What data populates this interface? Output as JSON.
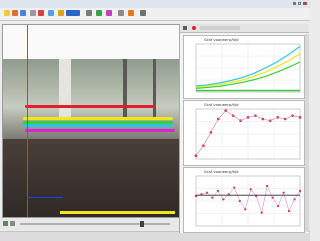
{
  "app": {
    "window_title": "",
    "window_buttons": [
      "minimize",
      "maximize",
      "close"
    ]
  },
  "toolbar": {
    "icons": [
      "new-icon",
      "open-icon",
      "save-icon",
      "undo-icon",
      "redo-icon",
      "zoom-icon",
      "record-icon",
      "tracker-icon",
      "settings-icon",
      "help-icon"
    ]
  },
  "colors": {
    "track_red": "#e0202a",
    "track_yellow": "#f2e61a",
    "track_green": "#3dcc3d",
    "track_cyan": "#28c7e6",
    "track_magenta": "#d327d3",
    "cursor_line": "#d020c8",
    "fit_line": "#c878c8"
  },
  "plots": [
    {
      "title": "Graf voorwerp/tijd"
    },
    {
      "title": "Graf voorwerp/tijd"
    },
    {
      "title": "Graf voorwerp/tijd"
    }
  ],
  "chart_data": [
    {
      "type": "line",
      "title": "",
      "series": [
        {
          "values": [
            0.5,
            0.6,
            0.75,
            0.95,
            1.2,
            1.55,
            2.0,
            2.5,
            3.1,
            3.8
          ]
        },
        {
          "values": [
            0.4,
            0.5,
            0.62,
            0.78,
            1.0,
            1.3,
            1.65,
            2.1,
            2.6,
            3.2
          ]
        },
        {
          "values": [
            0.3,
            0.38,
            0.48,
            0.62,
            0.8,
            1.02,
            1.3,
            1.65,
            2.05,
            2.5
          ]
        }
      ],
      "ylim": [
        0,
        4
      ]
    },
    {
      "type": "scatter",
      "title": "",
      "values": [
        0.2,
        0.8,
        1.6,
        2.4,
        2.9,
        2.6,
        2.3,
        2.5,
        2.6,
        2.4,
        2.3,
        2.5,
        2.4,
        2.6,
        2.5
      ],
      "ylim": [
        0,
        3
      ]
    },
    {
      "type": "scatter",
      "title": "",
      "values": [
        1.8,
        1.9,
        2.0,
        1.7,
        2.1,
        1.6,
        1.9,
        2.3,
        1.5,
        1.0,
        2.2,
        1.8,
        0.8,
        2.4,
        1.7,
        1.2,
        2.0,
        0.9,
        1.6,
        2.1
      ],
      "ylim": [
        0,
        3
      ]
    }
  ],
  "status": {
    "frame_text": "",
    "zoom": ""
  }
}
